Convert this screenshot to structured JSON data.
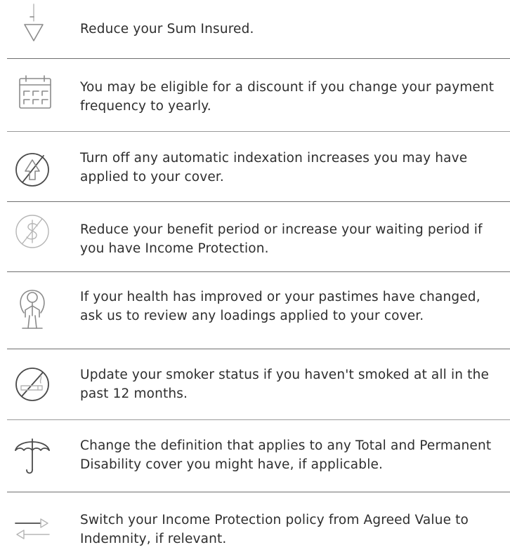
{
  "tips": [
    {
      "icon": "down-arrow-icon",
      "text": "Reduce your Sum Insured."
    },
    {
      "icon": "calendar-icon",
      "text": "You may be eligible for a discount if you change your payment frequency to yearly."
    },
    {
      "icon": "no-increase-icon",
      "text": "Turn off any automatic indexation increases you may have applied to your cover."
    },
    {
      "icon": "no-dollar-icon",
      "text": "Reduce your benefit period or increase your waiting period if you have Income Protection."
    },
    {
      "icon": "skipping-person-icon",
      "text": "If your health has improved or your pastimes have changed, ask us to review any loadings applied to your cover."
    },
    {
      "icon": "no-smoking-icon",
      "text": "Update your smoker status if you haven't smoked at all in the past 12 months."
    },
    {
      "icon": "umbrella-icon",
      "text": "Change the definition that applies to any Total and Permanent Disability cover you might have, if applicable."
    },
    {
      "icon": "switch-arrows-icon",
      "text": "Switch your Income Protection policy from Agreed Value to Indemnity, if relevant."
    }
  ]
}
